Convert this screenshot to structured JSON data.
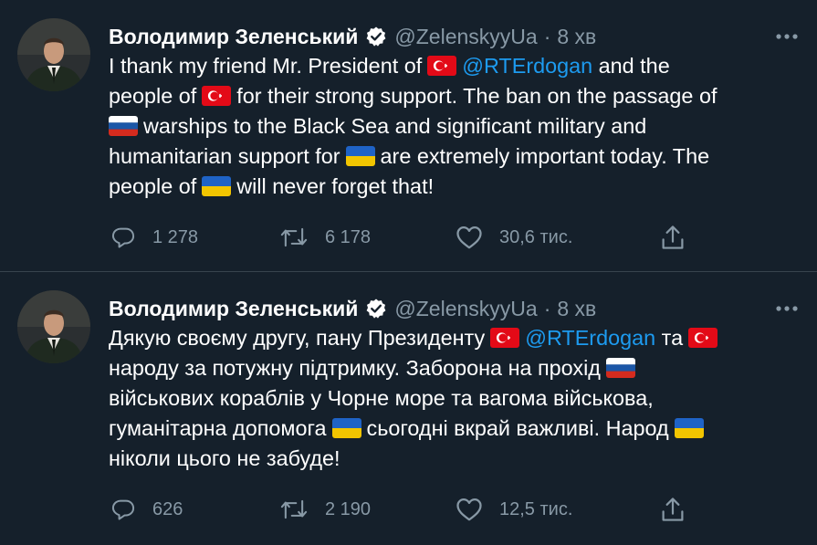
{
  "colors": {
    "background": "#15202b",
    "text": "#ffffff",
    "secondary": "#8899a6",
    "link": "#1d9bf0",
    "divider": "#38444d"
  },
  "tweets": [
    {
      "author": {
        "name": "Володимир Зеленський",
        "handle": "@ZelenskyyUa",
        "verified": true,
        "avatar_icon": "profile-photo"
      },
      "separator": "·",
      "time": "8 хв",
      "more_icon": "ellipsis-icon",
      "text": {
        "l1a": "I thank my friend Mr. President of",
        "l1_mention": "@RTErdogan",
        "l1b": "and the",
        "l2a": "people of",
        "l2b": "for their strong support. The ban on the passage of",
        "l3": "warships to the Black Sea and significant military and",
        "l4a": "humanitarian support for",
        "l4b": "are extremely important today. The",
        "l5a": "people of",
        "l5b": "will never forget that!"
      },
      "flags": [
        "turkey-flag",
        "turkey-flag",
        "russia-flag",
        "ukraine-flag",
        "ukraine-flag"
      ],
      "stats": {
        "replies": "1 278",
        "retweets": "6 178",
        "likes": "30,6 тис."
      }
    },
    {
      "author": {
        "name": "Володимир Зеленський",
        "handle": "@ZelenskyyUa",
        "verified": true,
        "avatar_icon": "profile-photo"
      },
      "separator": "·",
      "time": "8 хв",
      "more_icon": "ellipsis-icon",
      "text": {
        "l1a": "Дякую своєму другу, пану Президенту",
        "l1_mention": "@RTErdogan",
        "l1b": "та",
        "l2a": "народу за потужну підтримку. Заборона на прохід",
        "l3": "військових кораблів у Чорне море та вагома військова,",
        "l4a": "гуманітарна допомога",
        "l4b": "сьогодні вкрай важливі. Народ",
        "l5": "ніколи цього не забуде!"
      },
      "flags": [
        "turkey-flag",
        "turkey-flag",
        "russia-flag",
        "ukraine-flag",
        "ukraine-flag"
      ],
      "stats": {
        "replies": "626",
        "retweets": "2 190",
        "likes": "12,5 тис."
      }
    }
  ]
}
